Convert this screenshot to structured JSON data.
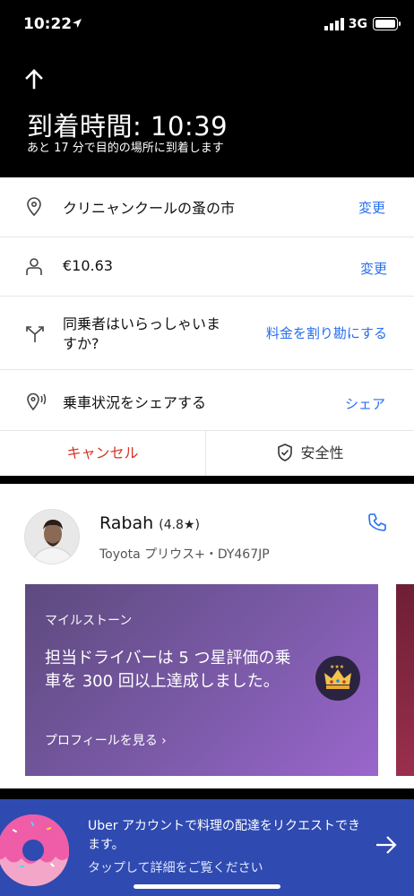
{
  "status_bar": {
    "time": "10:22",
    "network": "3G"
  },
  "header": {
    "title": "到着時間: 10:39",
    "subtitle": "あと 17 分で目的の場所に到着します"
  },
  "trip": {
    "destination": {
      "label": "クリニャンクールの蚤の市",
      "action": "変更"
    },
    "fare": {
      "label": "€10.63",
      "action": "変更"
    },
    "split": {
      "label": "同乗者はいらっしゃいますか?",
      "action": "料金を割り勘にする"
    },
    "share": {
      "label": "乗車状況をシェアする",
      "action": "シェア"
    },
    "cancel_label": "キャンセル",
    "safety_label": "安全性"
  },
  "driver": {
    "name": "Rabah",
    "rating": "(4.8★)",
    "vehicle": "Toyota プリウス+・DY467JP"
  },
  "milestone": {
    "kicker": "マイルストーン",
    "text": "担当ドライバーは 5 つ星評価の乗車を 300 回以上達成しました。",
    "link": "プロフィールを見る ›"
  },
  "promo": {
    "title": "Uber アカウントで料理の配達をリクエストできます。",
    "subtitle": "タップして詳細をご覧ください"
  },
  "colors": {
    "accent_blue": "#276ef1",
    "cancel_red": "#d63426",
    "promo_bg": "#2f4ab0"
  }
}
